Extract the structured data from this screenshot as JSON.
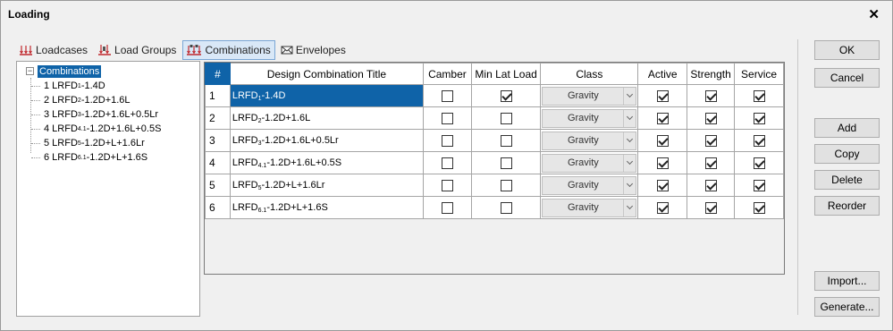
{
  "window": {
    "title": "Loading",
    "close_glyph": "✕"
  },
  "tabs": [
    {
      "label": "Loadcases",
      "icon": "loadcase-icon"
    },
    {
      "label": "Load Groups",
      "icon": "load-groups-icon"
    },
    {
      "label": "Combinations",
      "icon": "combinations-icon",
      "active": true
    },
    {
      "label": "Envelopes",
      "icon": "envelope-icon"
    }
  ],
  "tree": {
    "root_label": "Combinations",
    "expander": "−",
    "items": [
      {
        "pre": "1 LRFD",
        "sub": "1",
        "post": "-1.4D"
      },
      {
        "pre": "2 LRFD",
        "sub": "2",
        "post": "-1.2D+1.6L"
      },
      {
        "pre": "3 LRFD",
        "sub": "3",
        "post": "-1.2D+1.6L+0.5Lr"
      },
      {
        "pre": "4 LRFD",
        "sub": "4.1",
        "post": "-1.2D+1.6L+0.5S"
      },
      {
        "pre": "5 LRFD",
        "sub": "5",
        "post": "-1.2D+L+1.6Lr"
      },
      {
        "pre": "6 LRFD",
        "sub": "6.1",
        "post": "-1.2D+L+1.6S"
      }
    ]
  },
  "grid": {
    "headers": [
      "#",
      "Design Combination Title",
      "Camber",
      "Min Lat Load",
      "Class",
      "Active",
      "Strength",
      "Service"
    ],
    "rows": [
      {
        "idx": "1",
        "pre": "LRFD",
        "sub": "1",
        "post": "-1.4D",
        "camber": false,
        "min_lat": true,
        "class": "Gravity",
        "active": true,
        "strength": true,
        "service": true,
        "selected": true
      },
      {
        "idx": "2",
        "pre": "LRFD",
        "sub": "2",
        "post": "-1.2D+1.6L",
        "camber": false,
        "min_lat": false,
        "class": "Gravity",
        "active": true,
        "strength": true,
        "service": true
      },
      {
        "idx": "3",
        "pre": "LRFD",
        "sub": "3",
        "post": "-1.2D+1.6L+0.5Lr",
        "camber": false,
        "min_lat": false,
        "class": "Gravity",
        "active": true,
        "strength": true,
        "service": true
      },
      {
        "idx": "4",
        "pre": "LRFD",
        "sub": "4.1",
        "post": "-1.2D+1.6L+0.5S",
        "camber": false,
        "min_lat": false,
        "class": "Gravity",
        "active": true,
        "strength": true,
        "service": true
      },
      {
        "idx": "5",
        "pre": "LRFD",
        "sub": "5",
        "post": "-1.2D+L+1.6Lr",
        "camber": false,
        "min_lat": false,
        "class": "Gravity",
        "active": true,
        "strength": true,
        "service": true
      },
      {
        "idx": "6",
        "pre": "LRFD",
        "sub": "6.1",
        "post": "-1.2D+L+1.6S",
        "camber": false,
        "min_lat": false,
        "class": "Gravity",
        "active": true,
        "strength": true,
        "service": true
      }
    ]
  },
  "buttons": {
    "ok": "OK",
    "cancel": "Cancel",
    "add": "Add",
    "copy": "Copy",
    "delete": "Delete",
    "reorder": "Reorder",
    "import": "Import...",
    "generate": "Generate..."
  },
  "colors": {
    "selection": "#0f63a8",
    "accent_tab": "#d9e8f7",
    "icon_red": "#c0282d"
  }
}
